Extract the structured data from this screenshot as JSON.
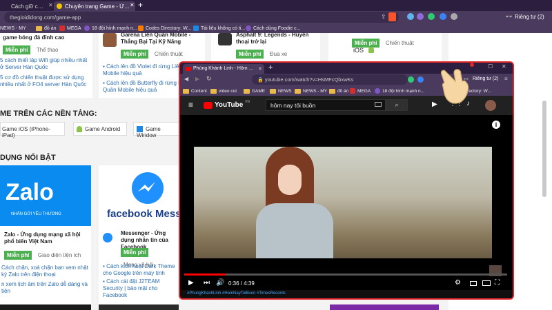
{
  "browser": {
    "tabs": [
      {
        "label": "Cách giữ của sổ bất kỳ hi..."
      },
      {
        "label": "Chuyên trang Game - Ứng dụng T..."
      }
    ],
    "url": "thegioididong.com/game-app",
    "private_label": "Riêng tư (2)",
    "bookmarks": [
      "NEWS - MY",
      "đồ án",
      "MEGA",
      "18 đội hình mạnh n...",
      "Codes Directory: W...",
      "Tài liệu không có ti...",
      "Cách dùng Foodie c..."
    ]
  },
  "page": {
    "col1_items": [
      {
        "title": "game bóng đá đỉnh cao",
        "badge": "Miễn phí",
        "category": "Thể thao"
      }
    ],
    "col1_links": [
      "5 cách thiết lập Wifi giúp nhiều nhất ở Server Hàn Quốc",
      "5 cơ đồ chiến thuật được sử dụng nhiều nhất ở FO4 server Hàn Quốc"
    ],
    "app2": {
      "title": "Garena Liên Quân Mobile - Thắng Bại Tại Kỹ Năng",
      "badge": "Miễn phí",
      "category": "Chiến thuật"
    },
    "app2_links": [
      "Cách lên đồ Violet đi rừng Liên Quân Mobile hiệu quả",
      "Cách lên đồ Butterfly đi rừng Liên Quân Mobile hiệu quả"
    ],
    "app3": {
      "title": "Asphalt 9: Legends - Huyền thoại trở lại",
      "badge": "Miễn phí",
      "category": "Đua xe"
    },
    "app4": {
      "badge": "Miễn phí",
      "category": "Chiến thuật",
      "os": "iOS"
    },
    "section_platforms": "ME TRÊN CÁC NỀN TẢNG:",
    "platforms": [
      "Game iOS (iPhone-iPad)",
      "Game Android",
      "Game Window"
    ],
    "section_featured": "DỤNG NỔI BẬT",
    "zalo": {
      "brand": "Zalo",
      "sub": "NHẮN GỬI YÊU THƯƠNG",
      "title": "Zalo - Ứng dụng mạng xã hội phổ biến Việt Nam",
      "badge": "Miễn phí",
      "category": "Giao diện tiện ích",
      "links": [
        "Cách chặn, xoá chặn bạn xem nhật ký Zalo trên điện thoại",
        "n xem lịch âm trên Zalo dễ dàng và tiện"
      ]
    },
    "messenger": {
      "brand": "facebook Messe",
      "title": "Messenger - Ứng dụng nhắn tin của Facebook",
      "badge": "Miễn phí",
      "category": "Mạng xã hội",
      "links": [
        "Cách kích hoạt Dark Theme cho Google trên máy tính",
        "Cách cài đặt J2TEAM Security | bảo mật cho Facebook"
      ]
    }
  },
  "front_window": {
    "tab_label": "Phùng Khánh Linh - Hôm Nay Tôi ...",
    "url": "youtube.com/watch?v=HsMFcQbxwKs",
    "private_label": "Riêng tư (2)",
    "bookmarks": [
      "Content",
      "video cut",
      "GAME",
      "NEWS",
      "NEWS - MY",
      "đồ án",
      "MEGA",
      "18 đội hình mạnh n...",
      "Directory: W..."
    ],
    "yt": {
      "logo": "YouTube",
      "region": "VN",
      "search_value": "hôm nay tôi buồn",
      "time": "0:36 / 4:39",
      "progress": 0.129,
      "hashtags": "#PhungKhanhLinh #HomNayToiBuon #TimesRecords"
    }
  },
  "colors": {
    "brand_red": "#e0262a",
    "green": "#4caf50",
    "browser_bg": "#4a3a5e"
  }
}
